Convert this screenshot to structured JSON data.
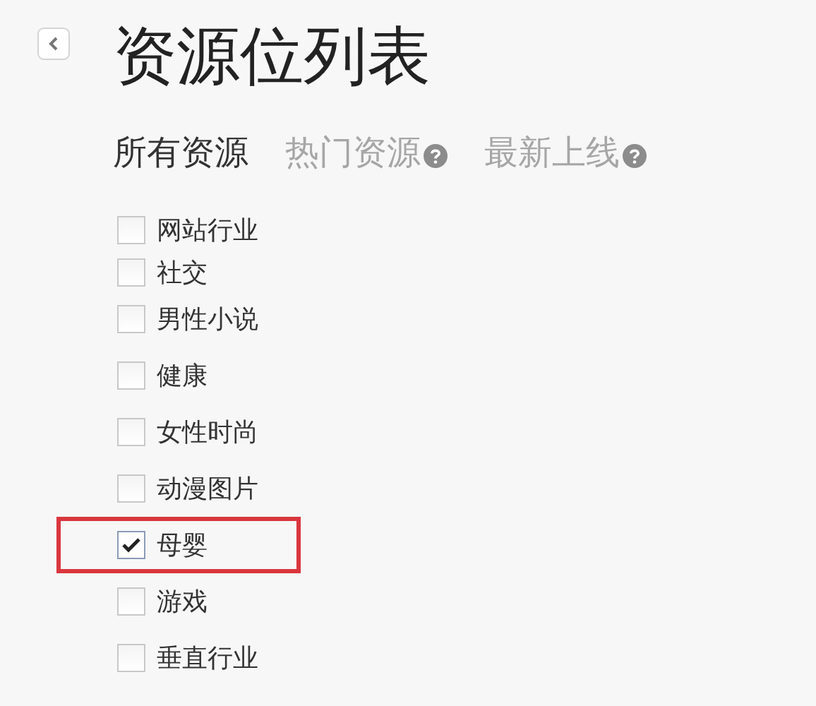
{
  "title": "资源位列表",
  "tabs": [
    {
      "label": "所有资源",
      "selected": true,
      "help": false
    },
    {
      "label": "热门资源",
      "selected": false,
      "help": true
    },
    {
      "label": "最新上线",
      "selected": false,
      "help": true
    }
  ],
  "categories": [
    {
      "label": "网站行业",
      "checked": false,
      "highlighted": false
    },
    {
      "label": "社交",
      "checked": false,
      "highlighted": false
    },
    {
      "label": "男性小说",
      "checked": false,
      "highlighted": false
    },
    {
      "label": "健康",
      "checked": false,
      "highlighted": false
    },
    {
      "label": "女性时尚",
      "checked": false,
      "highlighted": false
    },
    {
      "label": "动漫图片",
      "checked": false,
      "highlighted": false
    },
    {
      "label": "母婴",
      "checked": true,
      "highlighted": true
    },
    {
      "label": "游戏",
      "checked": false,
      "highlighted": false
    },
    {
      "label": "垂直行业",
      "checked": false,
      "highlighted": false
    }
  ]
}
